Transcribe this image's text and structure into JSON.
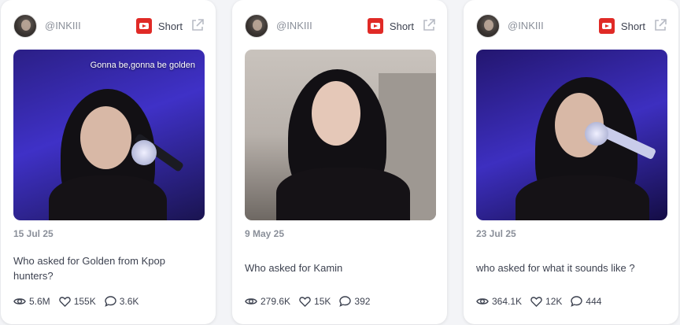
{
  "cards": [
    {
      "username": "@INKIII",
      "platform_label": "Short",
      "platform_icon": "youtube-icon",
      "caption": "Gonna be,gonna be golden",
      "date": "15 Jul 25",
      "title": "Who asked for Golden from Kpop hunters?",
      "views": "5.6M",
      "likes": "155K",
      "comments": "3.6K"
    },
    {
      "username": "@INKIII",
      "platform_label": "Short",
      "platform_icon": "youtube-icon",
      "caption": "",
      "date": "9 May 25",
      "title": "Who asked for Kamin",
      "views": "279.6K",
      "likes": "15K",
      "comments": "392"
    },
    {
      "username": "@INKIII",
      "platform_label": "Short",
      "platform_icon": "youtube-icon",
      "caption": "",
      "date": "23 Jul 25",
      "title": "who asked for what it sounds like ?",
      "views": "364.1K",
      "likes": "12K",
      "comments": "444"
    }
  ],
  "colors": {
    "youtube_red": "#e02a26",
    "text_dark": "#3d4250",
    "text_muted": "#8a8f99"
  }
}
